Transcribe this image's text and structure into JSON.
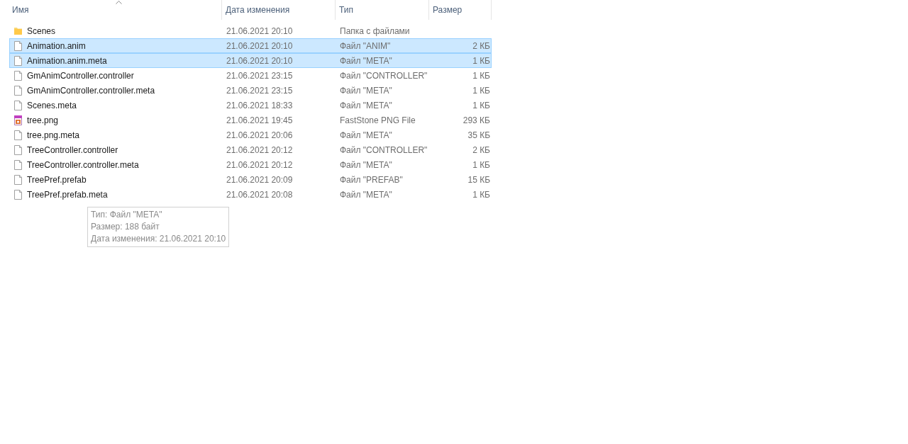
{
  "columns": [
    {
      "label": "Имя",
      "sorted": true
    },
    {
      "label": "Дата изменения",
      "sorted": false
    },
    {
      "label": "Тип",
      "sorted": false
    },
    {
      "label": "Размер",
      "sorted": false
    }
  ],
  "rows": [
    {
      "kind": "folder",
      "name": "Scenes",
      "date": "21.06.2021 20:10",
      "type": "Папка с файлами",
      "selected": false
    },
    {
      "kind": "file",
      "name": "Animation.anim",
      "date": "21.06.2021 20:10",
      "type": "Файл \"ANIM\"",
      "size": "2 КБ",
      "selected": true
    },
    {
      "kind": "file",
      "name": "Animation.anim.meta",
      "date": "21.06.2021 20:10",
      "type": "Файл \"META\"",
      "size": "1 КБ",
      "selected": true
    },
    {
      "kind": "file",
      "name": "GmAnimController.controller",
      "date": "21.06.2021 23:15",
      "type": "Файл \"CONTROLLER\"",
      "size": "1 КБ",
      "selected": false
    },
    {
      "kind": "file",
      "name": "GmAnimController.controller.meta",
      "date": "21.06.2021 23:15",
      "type": "Файл \"META\"",
      "size": "1 КБ",
      "selected": false
    },
    {
      "kind": "file",
      "name": "Scenes.meta",
      "date": "21.06.2021 18:33",
      "type": "Файл \"META\"",
      "size": "1 КБ",
      "selected": false
    },
    {
      "kind": "image",
      "name": "tree.png",
      "date": "21.06.2021 19:45",
      "type": "FastStone PNG File",
      "size": "293 КБ",
      "selected": false
    },
    {
      "kind": "file",
      "name": "tree.png.meta",
      "date": "21.06.2021 20:06",
      "type": "Файл \"META\"",
      "size": "35 КБ",
      "selected": false
    },
    {
      "kind": "file",
      "name": "TreeController.controller",
      "date": "21.06.2021 20:12",
      "type": "Файл \"CONTROLLER\"",
      "size": "2 КБ",
      "selected": false
    },
    {
      "kind": "file",
      "name": "TreeController.controller.meta",
      "date": "21.06.2021 20:12",
      "type": "Файл \"META\"",
      "size": "1 КБ",
      "selected": false
    },
    {
      "kind": "file",
      "name": "TreePref.prefab",
      "date": "21.06.2021 20:09",
      "type": "Файл \"PREFAB\"",
      "size": "15 КБ",
      "selected": false
    },
    {
      "kind": "file",
      "name": "TreePref.prefab.meta",
      "date": "21.06.2021 20:08",
      "type": "Файл \"META\"",
      "size": "1 КБ",
      "selected": false
    }
  ],
  "tooltip": {
    "lines": [
      "Тип: Файл \"META\"",
      "Размер: 188 байт",
      "Дата изменения: 21.06.2021 20:10"
    ]
  }
}
